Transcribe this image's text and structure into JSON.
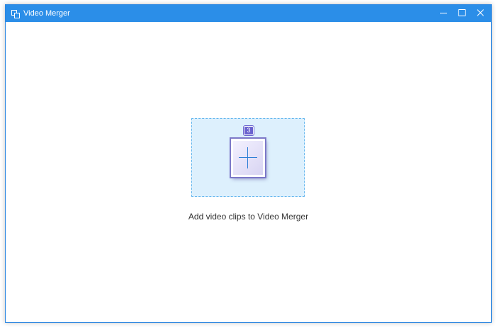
{
  "window": {
    "title": "Video Merger",
    "accent_color": "#2b8ee8",
    "controls": {
      "minimize_icon": "minimize-icon",
      "maximize_icon": "maximize-icon",
      "close_icon": "close-icon"
    }
  },
  "drop_zone": {
    "badge_count": "3",
    "icon": "plus-icon",
    "hint": "Add video clips to Video Merger"
  }
}
